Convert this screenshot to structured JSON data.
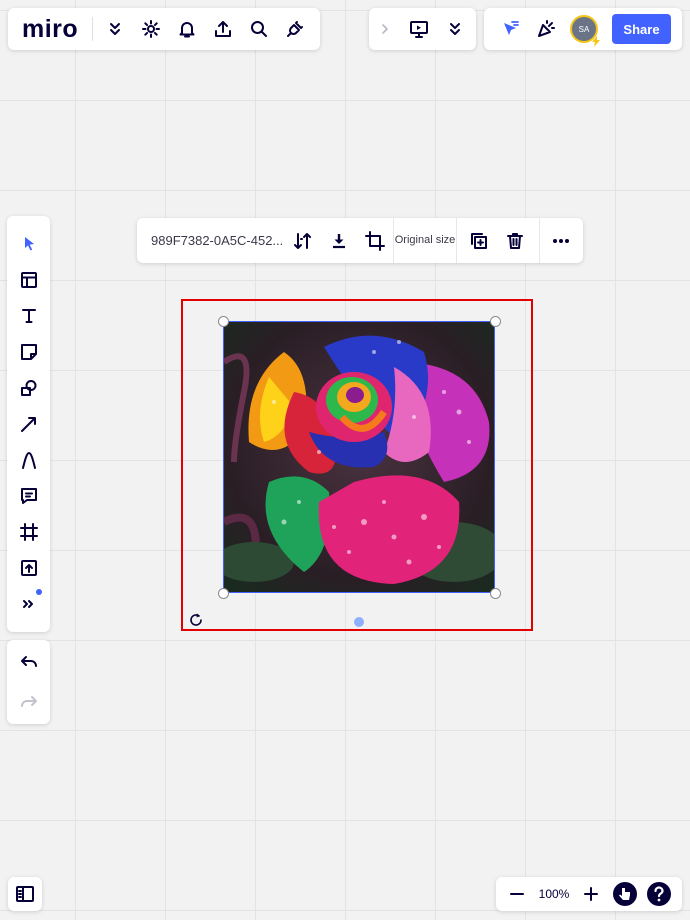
{
  "app": {
    "logo": "miro"
  },
  "top_bar": {
    "left_icons": [
      "chevron-double-down-icon",
      "gear-icon",
      "bell-icon",
      "upload-icon",
      "search-icon",
      "plug-icon"
    ],
    "share_label": "Share",
    "avatar_initials": "SA"
  },
  "context_toolbar": {
    "file_name": "989F7382-0A5C-452...",
    "original_size_label": "Original size"
  },
  "zoom": {
    "level": "100%"
  },
  "colors": {
    "accent": "#4262ff",
    "selection_highlight": "#e30000",
    "text": "#050038"
  }
}
